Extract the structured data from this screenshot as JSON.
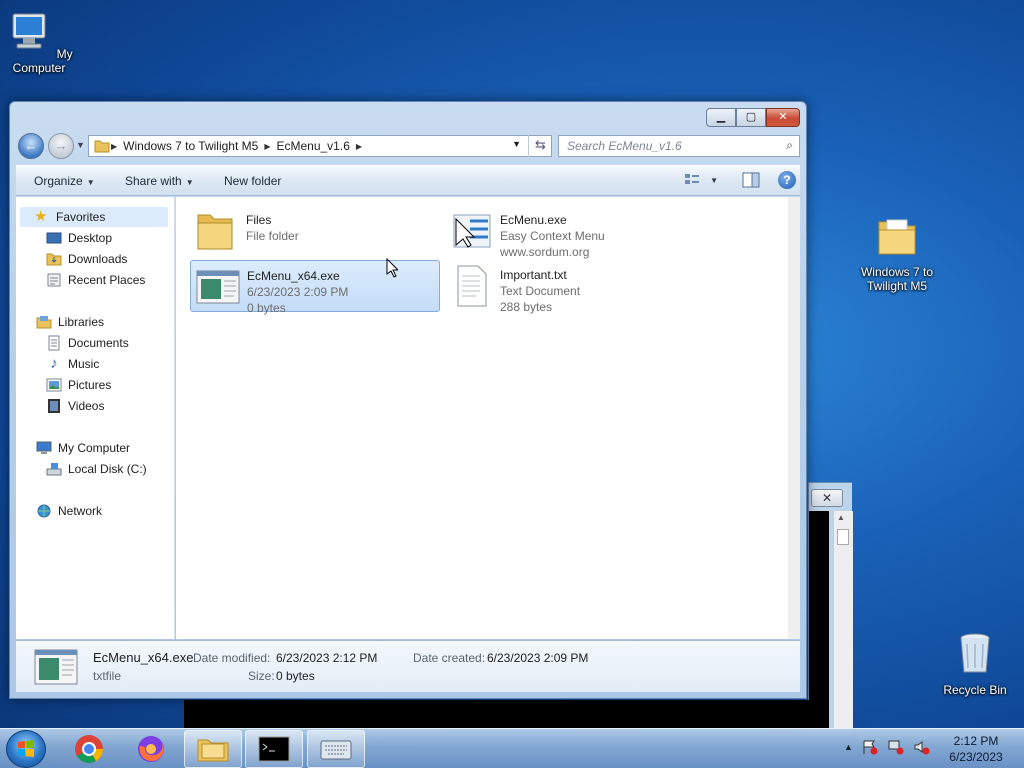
{
  "desktop": {
    "icons": [
      {
        "label": "My Computer"
      },
      {
        "label": "Windows 7 to Twilight M5"
      },
      {
        "label": "Recycle Bin"
      }
    ]
  },
  "console": {
    "close_glyph": "✕"
  },
  "explorer": {
    "buttons": {
      "minimize": "▁",
      "maximize": "▢",
      "close": "✕"
    },
    "breadcrumb": [
      "Windows 7 to Twilight M5",
      "EcMenu_v1.6"
    ],
    "search_placeholder": "Search EcMenu_v1.6",
    "toolbar": {
      "organize": "Organize",
      "share_with": "Share with",
      "new_folder": "New folder"
    },
    "nav": {
      "favorites": "Favorites",
      "desktop": "Desktop",
      "downloads": "Downloads",
      "recent_places": "Recent Places",
      "libraries": "Libraries",
      "documents": "Documents",
      "music": "Music",
      "pictures": "Pictures",
      "videos": "Videos",
      "my_computer": "My Computer",
      "local_disk": "Local Disk (C:)",
      "network": "Network"
    },
    "files": [
      {
        "name": "Files",
        "line1": "File folder",
        "line2": ""
      },
      {
        "name": "EcMenu.exe",
        "line1": "Easy Context Menu",
        "line2": "www.sordum.org"
      },
      {
        "name": "EcMenu_x64.exe",
        "line1": "6/23/2023 2:09 PM",
        "line2": "0 bytes"
      },
      {
        "name": "Important.txt",
        "line1": "Text Document",
        "line2": "288 bytes"
      }
    ],
    "details": {
      "name": "EcMenu_x64.exe",
      "type": "txtfile",
      "modified_label": "Date modified:",
      "modified": "6/23/2023 2:12 PM",
      "created_label": "Date created:",
      "created": "6/23/2023 2:09 PM",
      "size_label": "Size:",
      "size": "0 bytes"
    }
  },
  "taskbar": {
    "clock_time": "2:12 PM",
    "clock_date": "6/23/2023",
    "tray_arrow": "▲"
  }
}
